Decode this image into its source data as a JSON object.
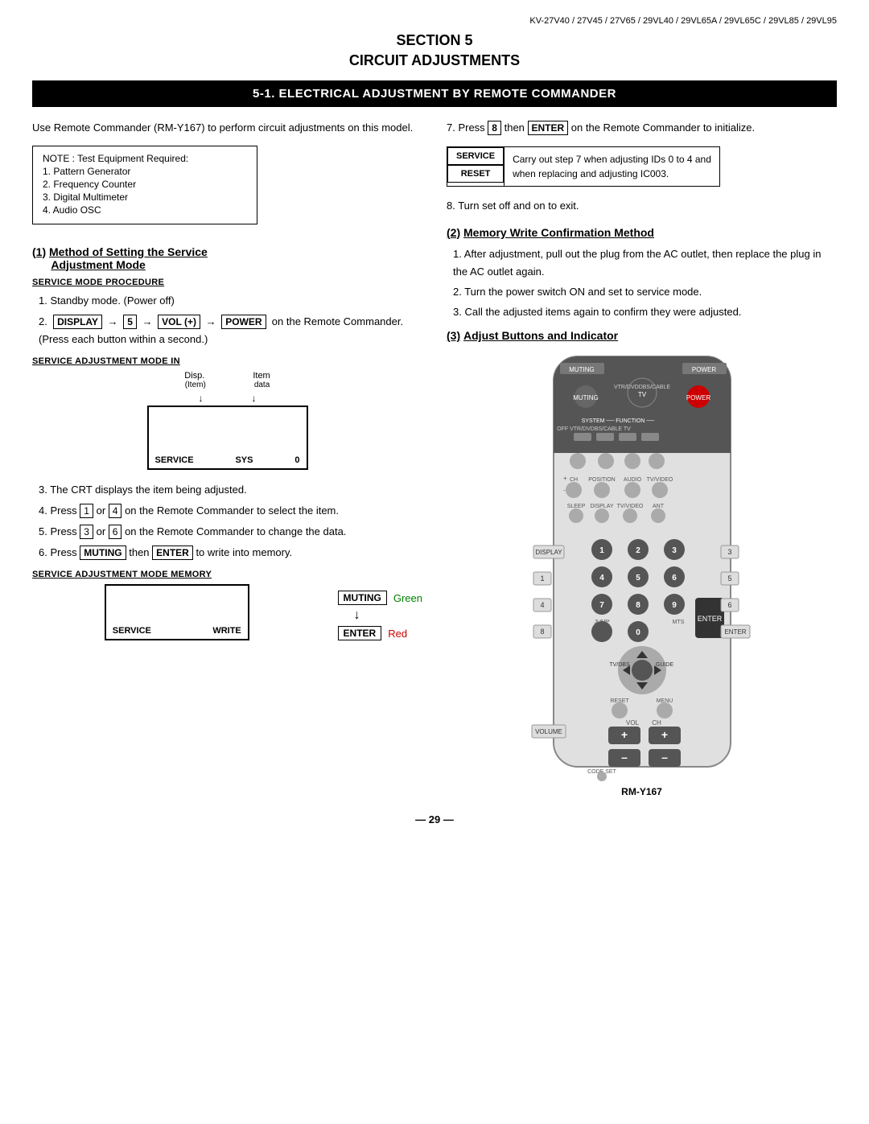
{
  "header": {
    "model_numbers": "KV-27V40 / 27V45 / 27V65 / 29VL40 / 29VL65A / 29VL65C / 29VL85 / 29VL95"
  },
  "section": {
    "number": "SECTION 5",
    "title": "CIRCUIT ADJUSTMENTS"
  },
  "main_heading": "5-1.  ELECTRICAL ADJUSTMENT BY REMOTE COMMANDER",
  "intro": {
    "text": "Use Remote Commander (RM-Y167) to perform circuit adjustments on this model."
  },
  "note_box": {
    "title": "NOTE : Test Equipment Required:",
    "items": [
      "1.  Pattern Generator",
      "2.  Frequency Counter",
      "3.  Digital Multimeter",
      "4.  Audio OSC"
    ]
  },
  "section1": {
    "number": "(1)",
    "title": "Method of Setting the Service",
    "subtitle": "Adjustment Mode",
    "procedure_heading": "SERVICE MODE PROCEDURE",
    "steps": [
      "1.  Standby mode. (Power off)",
      "2.  DISPLAY → 5 → VOL (+) → POWER on the Remote Commander. (Press each button within a second.)"
    ],
    "adj_mode_heading": "SERVICE  ADJUSTMENT MODE IN",
    "disp_labels": [
      "Disp.",
      "Item"
    ],
    "disp_sublabels": [
      "(Item)",
      "data"
    ],
    "screen_service": "SERVICE",
    "screen_sys": "SYS",
    "screen_num": "0",
    "more_steps": [
      "3.  The CRT displays the item being adjusted.",
      "4.  Press 1 or 4 on the Remote Commander to select the item.",
      "5.  Press 3 or 6 on the Remote Commander to change the data.",
      "6.  Press MUTING then ENTER to write into memory."
    ],
    "memory_heading": "SERVICE  ADJUSTMENT MODE MEMORY",
    "screen_service2": "SERVICE",
    "screen_write": "WRITE",
    "muting_label": "MUTING",
    "muting_color": "Green",
    "enter_label": "ENTER",
    "enter_color": "Red",
    "step8": "8.  Turn set off and on to exit."
  },
  "section2": {
    "number": "(2)",
    "title": "Memory Write Confirmation Method",
    "steps": [
      "1.  After adjustment, pull out the plug from the AC outlet, then replace the plug in the AC outlet again.",
      "2.  Turn the power switch ON and set to service mode.",
      "3.  Call the adjusted items again to confirm they were adjusted."
    ],
    "service_reset": {
      "service_label": "SERVICE",
      "reset_label": "RESET",
      "description": "Carry out step 7 when adjusting IDs 0 to 4 and when replacing and adjusting IC003."
    },
    "step7": "7.  Press 8 then ENTER on the Remote Commander to initialize."
  },
  "section3": {
    "number": "(3)",
    "title": "Adjust Buttons and Indicator",
    "remote_label": "RM-Y167"
  },
  "page_number": "— 29 —"
}
